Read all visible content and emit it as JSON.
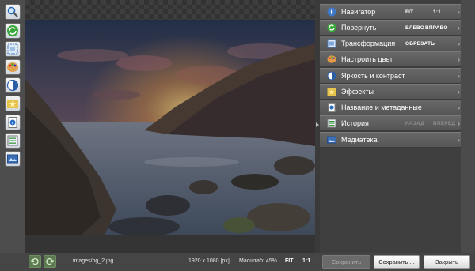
{
  "toolbar": {
    "tools": [
      {
        "icon": "magnifier-icon"
      },
      {
        "icon": "rotate-icon"
      },
      {
        "icon": "crop-icon"
      },
      {
        "icon": "palette-icon"
      },
      {
        "icon": "contrast-icon"
      },
      {
        "icon": "sparkle-icon"
      },
      {
        "icon": "document-info-icon"
      },
      {
        "icon": "history-list-icon"
      },
      {
        "icon": "media-library-icon"
      }
    ]
  },
  "panel": {
    "navigator": {
      "label": "Навигатор",
      "fit": "FIT",
      "ratio": "1:1"
    },
    "rotate": {
      "label": "Повернуть",
      "left": "ВЛЕВО",
      "right": "ВПРАВО"
    },
    "transform": {
      "label": "Трансформация",
      "crop": "ОБРЕЗАТЬ"
    },
    "color": {
      "label": "Настроить цвет"
    },
    "brightness": {
      "label": "Яркость и контраст"
    },
    "effects": {
      "label": "Эффекты"
    },
    "metadata": {
      "label": "Название и метаданные"
    },
    "history": {
      "label": "История",
      "back": "НАЗАД",
      "forward": "ВПЕРЕД"
    },
    "media": {
      "label": "Медиатека"
    }
  },
  "status": {
    "file": "images/bg_2.jpg",
    "dimensions": "1920 x 1080 [px]",
    "zoom": "Масштаб: 45%",
    "fit": "FIT",
    "ratio": "1:1"
  },
  "buttons": {
    "save": "Сохранить",
    "save_as": "Сохранить ...",
    "close": "Закрыть"
  },
  "colors": {
    "panel_row": "#5f5f5f",
    "undo_green": "#5d7a52"
  }
}
